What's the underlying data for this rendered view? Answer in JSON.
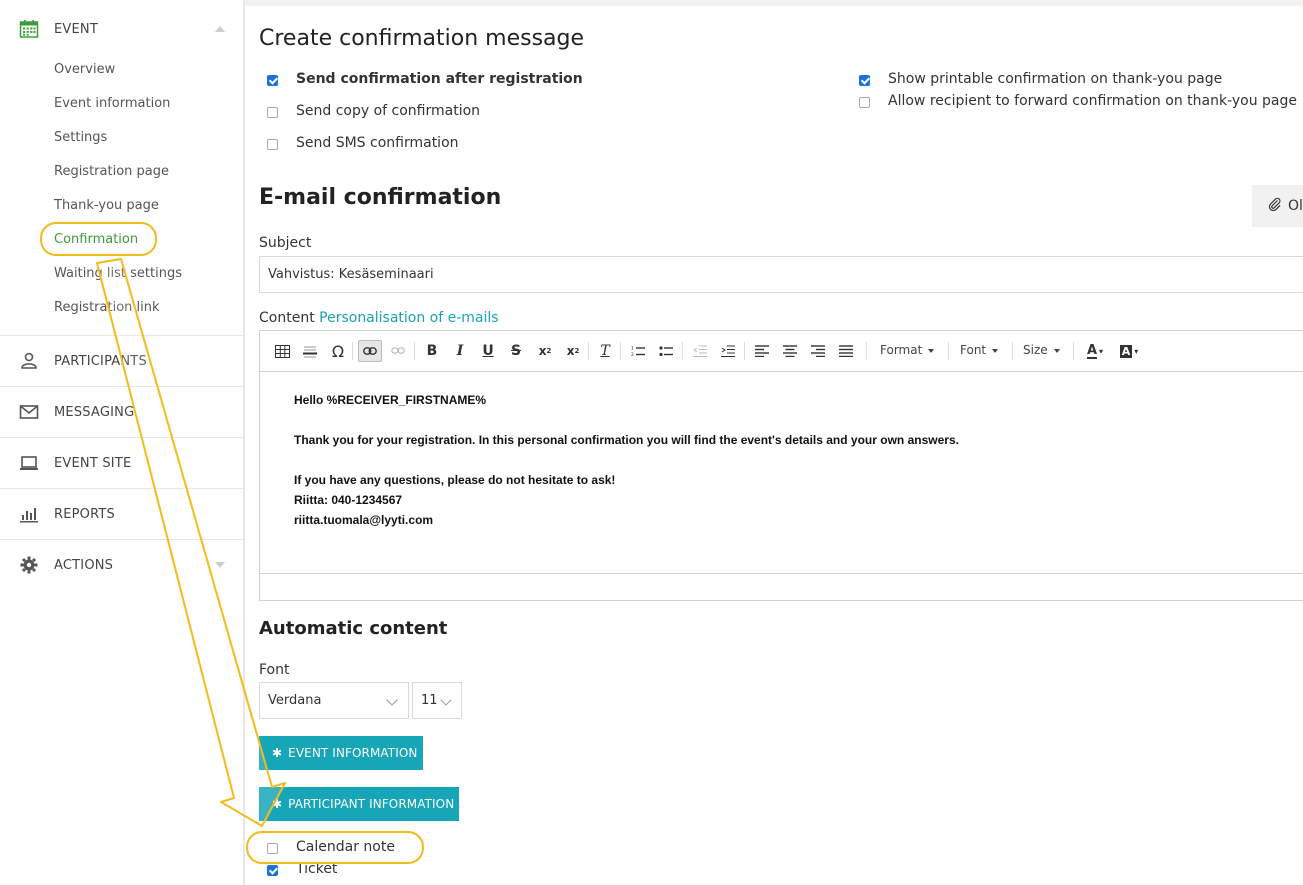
{
  "sidebar": {
    "event_section": {
      "label": "EVENT",
      "icon": "calendar-icon"
    },
    "sub_items": [
      {
        "label": "Overview"
      },
      {
        "label": "Event information"
      },
      {
        "label": "Settings"
      },
      {
        "label": "Registration page"
      },
      {
        "label": "Thank-you page"
      },
      {
        "label": "Confirmation",
        "active": true
      },
      {
        "label": "Waiting list settings"
      },
      {
        "label": "Registration link"
      }
    ],
    "sections": [
      {
        "label": "PARTICIPANTS",
        "icon": "participants-icon"
      },
      {
        "label": "MESSAGING",
        "icon": "envelope-icon"
      },
      {
        "label": "EVENT SITE",
        "icon": "laptop-icon"
      },
      {
        "label": "REPORTS",
        "icon": "bar-chart-icon"
      },
      {
        "label": "ACTIONS",
        "icon": "gear-icon"
      }
    ]
  },
  "main": {
    "title": "Create confirmation message",
    "options_left": [
      {
        "label": "Send confirmation after registration",
        "checked": true
      },
      {
        "label": "Send copy of confirmation",
        "checked": false
      },
      {
        "label": "Send SMS confirmation",
        "checked": false
      }
    ],
    "options_right": [
      {
        "label": "Show printable confirmation on thank-you page",
        "checked": true
      },
      {
        "label": "Allow recipient to forward confirmation on thank-you page",
        "checked": false
      }
    ],
    "email_title": "E-mail confirmation",
    "attach_button_label": "Ol",
    "subject_label": "Subject",
    "subject_value": "Vahvistus: Kesäseminaari",
    "content_label": "Content",
    "content_link": "Personalisation of e-mails",
    "toolbar": {
      "format": "Format",
      "font": "Font",
      "size": "Size"
    },
    "editor_lines": [
      "Hello %RECEIVER_FIRSTNAME%",
      "",
      "Thank you for your registration. In this personal confirmation you will find the event's details and your own answers.",
      "",
      "If you have any questions, please do not hesitate to ask!",
      "Riitta: 040-1234567",
      "riitta.tuomala@lyyti.com"
    ],
    "automatic_title": "Automatic content",
    "font_label": "Font",
    "font_value": "Verdana",
    "font_size_value": "11",
    "event_info_button": "EVENT INFORMATION",
    "participant_info_button": "PARTICIPANT INFORMATION",
    "bottom_options": [
      {
        "label": "Calendar note",
        "checked": false
      },
      {
        "label": "Ticket",
        "checked": true
      }
    ]
  },
  "colors": {
    "accent_teal": "#17a6b8",
    "active_green": "#3e9b3a",
    "highlight_yellow": "#f3bb1c",
    "checkbox_blue": "#1a73d9"
  }
}
